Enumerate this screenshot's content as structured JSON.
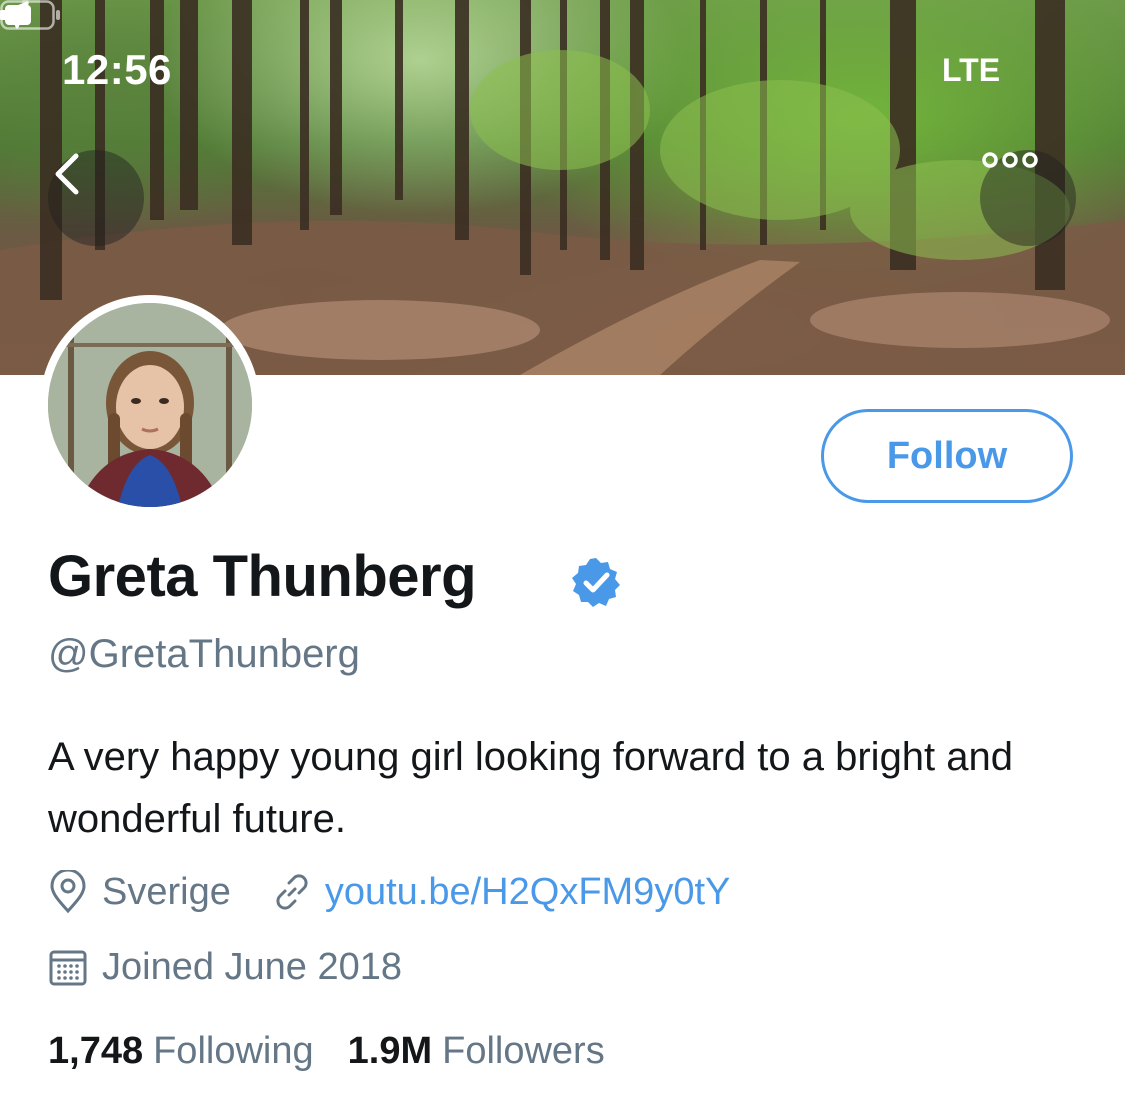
{
  "status_bar": {
    "time": "12:56",
    "network": "LTE"
  },
  "header": {
    "back_icon": "chevron-left-icon",
    "more_icon": "more-dots-icon"
  },
  "profile": {
    "name": "Greta Thunberg",
    "handle": "@GretaThunberg",
    "verified": true,
    "bio": "A very happy young girl looking forward to a bright and wonderful future.",
    "location": "Sverige",
    "link": "youtu.be/H2QxFM9y0tY",
    "joined": "Joined June 2018",
    "following_count": "1,748",
    "following_label": "Following",
    "followers_count": "1.9M",
    "followers_label": "Followers"
  },
  "actions": {
    "follow_label": "Follow"
  },
  "colors": {
    "accent": "#4a99e9",
    "text_primary": "#14171a",
    "text_secondary": "#657786"
  }
}
